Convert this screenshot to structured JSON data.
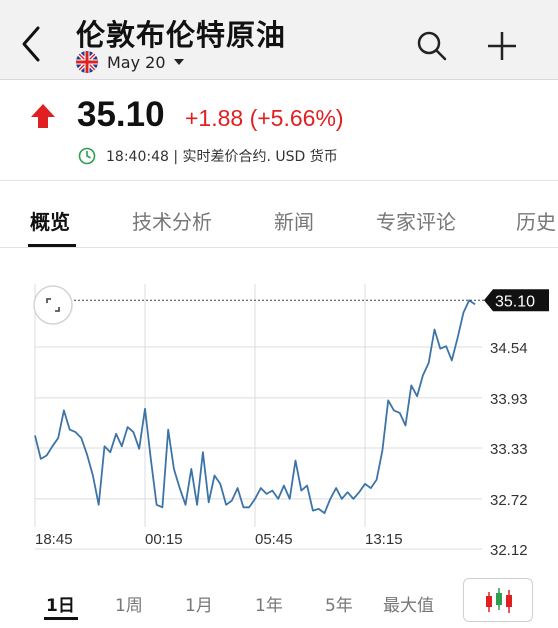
{
  "header": {
    "title": "伦敦布伦特原油",
    "date_label": "May 20",
    "flag": "uk-flag-icon",
    "icons": [
      "back-chevron-icon",
      "search-icon",
      "plus-icon"
    ]
  },
  "quote": {
    "price": "35.10",
    "change": "+1.88 (+5.66%)",
    "time_info": "18:40:48 | 实时差价合约.  USD 货币",
    "colors": {
      "up": "#e02020",
      "clock": "#2e9e4f"
    }
  },
  "tabs": [
    {
      "label": "概览",
      "active": true
    },
    {
      "label": "技术分析",
      "active": false
    },
    {
      "label": "新闻",
      "active": false
    },
    {
      "label": "专家评论",
      "active": false
    },
    {
      "label": "历史",
      "active": false
    }
  ],
  "chart_data": {
    "type": "line",
    "current_label": "35.10",
    "y_ticks": [
      "34.54",
      "33.93",
      "33.33",
      "32.72",
      "32.12"
    ],
    "x_ticks": [
      "18:45",
      "00:15",
      "05:45",
      "13:15"
    ],
    "ylim": [
      32.12,
      35.15
    ],
    "grid": true,
    "line_color": "#3d74a8",
    "values": [
      33.48,
      33.2,
      33.24,
      33.35,
      33.45,
      33.78,
      33.55,
      33.52,
      33.45,
      33.25,
      33.0,
      32.65,
      33.35,
      33.28,
      33.5,
      33.35,
      33.58,
      33.52,
      33.32,
      33.8,
      33.2,
      32.65,
      32.62,
      33.55,
      33.08,
      32.85,
      32.65,
      33.08,
      32.65,
      33.28,
      32.68,
      33.0,
      32.9,
      32.65,
      32.7,
      32.85,
      32.62,
      32.62,
      32.72,
      32.85,
      32.78,
      32.82,
      32.72,
      32.88,
      32.72,
      33.18,
      32.82,
      32.88,
      32.58,
      32.6,
      32.55,
      32.72,
      32.85,
      32.72,
      32.8,
      32.72,
      32.8,
      32.9,
      32.85,
      32.95,
      33.3,
      33.9,
      33.78,
      33.75,
      33.6,
      34.08,
      33.95,
      34.2,
      34.35,
      34.75,
      34.52,
      34.55,
      34.38,
      34.65,
      34.95,
      35.1,
      35.05
    ]
  },
  "ranges": [
    {
      "label": "1日",
      "active": true
    },
    {
      "label": "1周",
      "active": false
    },
    {
      "label": "1月",
      "active": false
    },
    {
      "label": "1年",
      "active": false
    },
    {
      "label": "5年",
      "active": false
    },
    {
      "label": "最大值",
      "active": false
    }
  ]
}
